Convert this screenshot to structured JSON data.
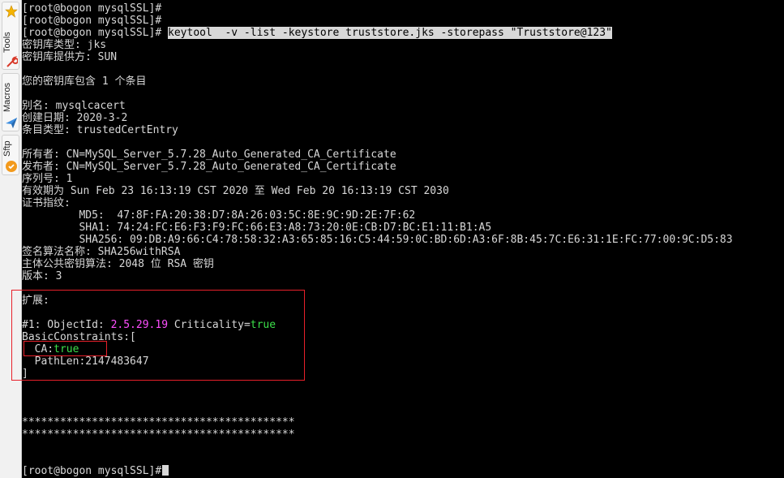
{
  "sidebar": {
    "tabs": [
      {
        "label": "Tools",
        "icon": "star-icon"
      },
      {
        "label": "Macros",
        "icon": "wrench-icon"
      },
      {
        "label": "Sftp",
        "icon": "paperplane-icon"
      }
    ]
  },
  "terminal": {
    "prompt": "[root@bogon mysqlSSL]#",
    "command": "keytool  -v -list -keystore truststore.jks -storepass \"Truststore@123\"",
    "lines": [
      "密钥库类型: jks",
      "密钥库提供方: SUN",
      "",
      "您的密钥库包含 1 个条目",
      "",
      "别名: mysqlcacert",
      "创建日期: 2020-3-2",
      "条目类型: trustedCertEntry",
      "",
      "所有者: CN=MySQL_Server_5.7.28_Auto_Generated_CA_Certificate",
      "发布者: CN=MySQL_Server_5.7.28_Auto_Generated_CA_Certificate",
      "序列号: 1",
      "有效期为 Sun Feb 23 16:13:19 CST 2020 至 Wed Feb 20 16:13:19 CST 2030",
      "证书指纹:",
      "         MD5:  47:8F:FA:20:38:D7:8A:26:03:5C:8E:9C:9D:2E:7F:62",
      "         SHA1: 74:24:FC:E6:F3:F9:FC:66:E3:A8:73:20:0E:CB:D7:BC:E1:11:B1:A5",
      "         SHA256: 09:DB:A9:66:C4:78:58:32:A3:65:85:16:C5:44:59:0C:BD:6D:A3:6F:8B:45:7C:E6:31:1E:FC:77:00:9C:D5:83",
      "签名算法名称: SHA256withRSA",
      "主体公共密钥算法: 2048 位 RSA 密钥",
      "版本: 3",
      "",
      "扩展:",
      ""
    ],
    "ext_id_prefix": "#1: ObjectId: ",
    "ext_id_value": "2.5.29.19",
    "ext_crit_label": " Criticality=",
    "ext_crit_value": "true",
    "basic_constraints": "BasicConstraints:[",
    "ca_label": "  CA:",
    "ca_value": "true",
    "pathlen": "  PathLen:2147483647",
    "close_bracket": "]",
    "stars_1": "*******************************************",
    "stars_2": "*******************************************"
  },
  "colors": {
    "highlight_box": "#e8202a",
    "magenta": "#ff4fff",
    "green": "#3ce04a"
  }
}
